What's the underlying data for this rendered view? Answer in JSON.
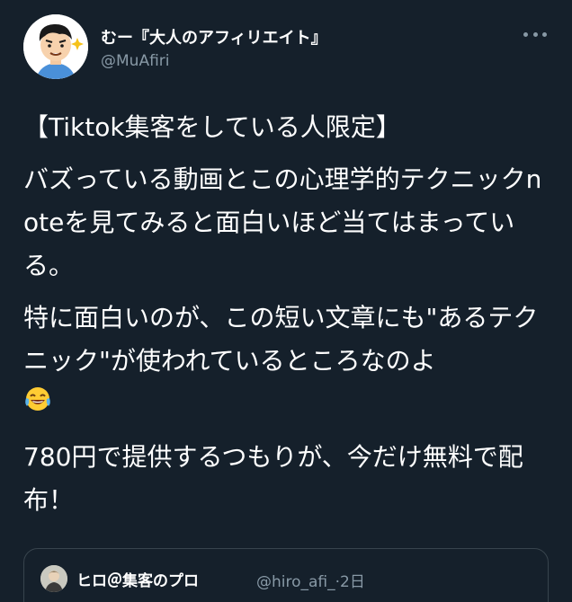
{
  "author": {
    "display_name": "むー『大人のアフィリエイト』",
    "handle": "@MuAfiri"
  },
  "tweet": {
    "paragraphs": [
      "【Tiktok集客をしている人限定】",
      "バズっている動画とこの心理学的テクニックnoteを見てみると面白いほど当てはまっている。",
      "特に面白いのが、この短い文章にも\"あるテクニック\"が使われているところなのよ",
      "780円で提供するつもりが、今だけ無料で配布！"
    ],
    "emoji": "laughing-with-tears"
  },
  "quoted": {
    "display_name": "ヒロ＠集客のプロ",
    "handle": "@hiro_afi_",
    "time": "·2日"
  },
  "colors": {
    "background": "#15202b",
    "text_primary": "#ffffff",
    "text_secondary": "#8899a6",
    "border": "#38444d"
  },
  "icons": {
    "more": "more-horizontal-icon"
  }
}
